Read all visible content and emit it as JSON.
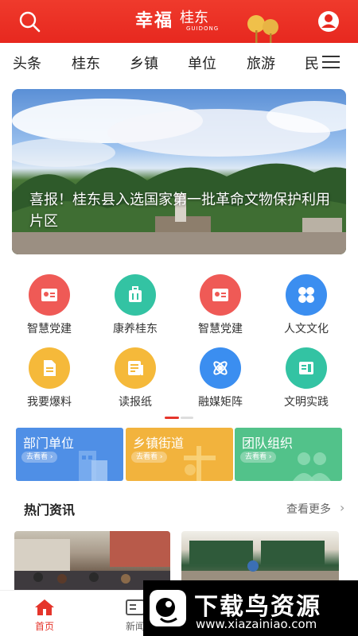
{
  "header": {
    "logo_main": "幸福",
    "logo_sub": "桂东",
    "logo_en": "GUIDONG",
    "brand_color": "#e7281f"
  },
  "tabs": [
    "头条",
    "桂东",
    "乡镇",
    "单位",
    "旅游",
    "民"
  ],
  "banner": {
    "title": "喜报！桂东县入选国家第一批革命文物保护利用片区"
  },
  "grid": [
    {
      "label": "智慧党建",
      "color": "#ef5a56",
      "icon": "party-building-icon"
    },
    {
      "label": "康养桂东",
      "color": "#33c3a3",
      "icon": "suitcase-icon"
    },
    {
      "label": "智慧党建",
      "color": "#ef5a56",
      "icon": "party-building-icon"
    },
    {
      "label": "人文文化",
      "color": "#3b8ef0",
      "icon": "clover-icon"
    },
    {
      "label": "我要爆料",
      "color": "#f5b93a",
      "icon": "document-icon"
    },
    {
      "label": "读报纸",
      "color": "#f5b93a",
      "icon": "newspaper-icon"
    },
    {
      "label": "融媒矩阵",
      "color": "#3b8ef0",
      "icon": "atom-icon"
    },
    {
      "label": "文明实践",
      "color": "#33c3a3",
      "icon": "book-icon"
    }
  ],
  "cards": [
    {
      "title": "部门单位",
      "pill": "去看看 ›",
      "color": "#4f8fe6"
    },
    {
      "title": "乡镇街道",
      "pill": "去看看 ›",
      "color": "#f2b33d"
    },
    {
      "title": "团队组织",
      "pill": "去看看 ›",
      "color": "#52c28a"
    }
  ],
  "hot_news": {
    "title": "热门资讯",
    "more": "查看更多"
  },
  "bottom_nav": [
    {
      "label": "首页",
      "active": true
    },
    {
      "label": "新闻",
      "active": false
    }
  ],
  "watermark": {
    "title": "下载鸟资源",
    "url": "www.xiazainiao.com"
  }
}
